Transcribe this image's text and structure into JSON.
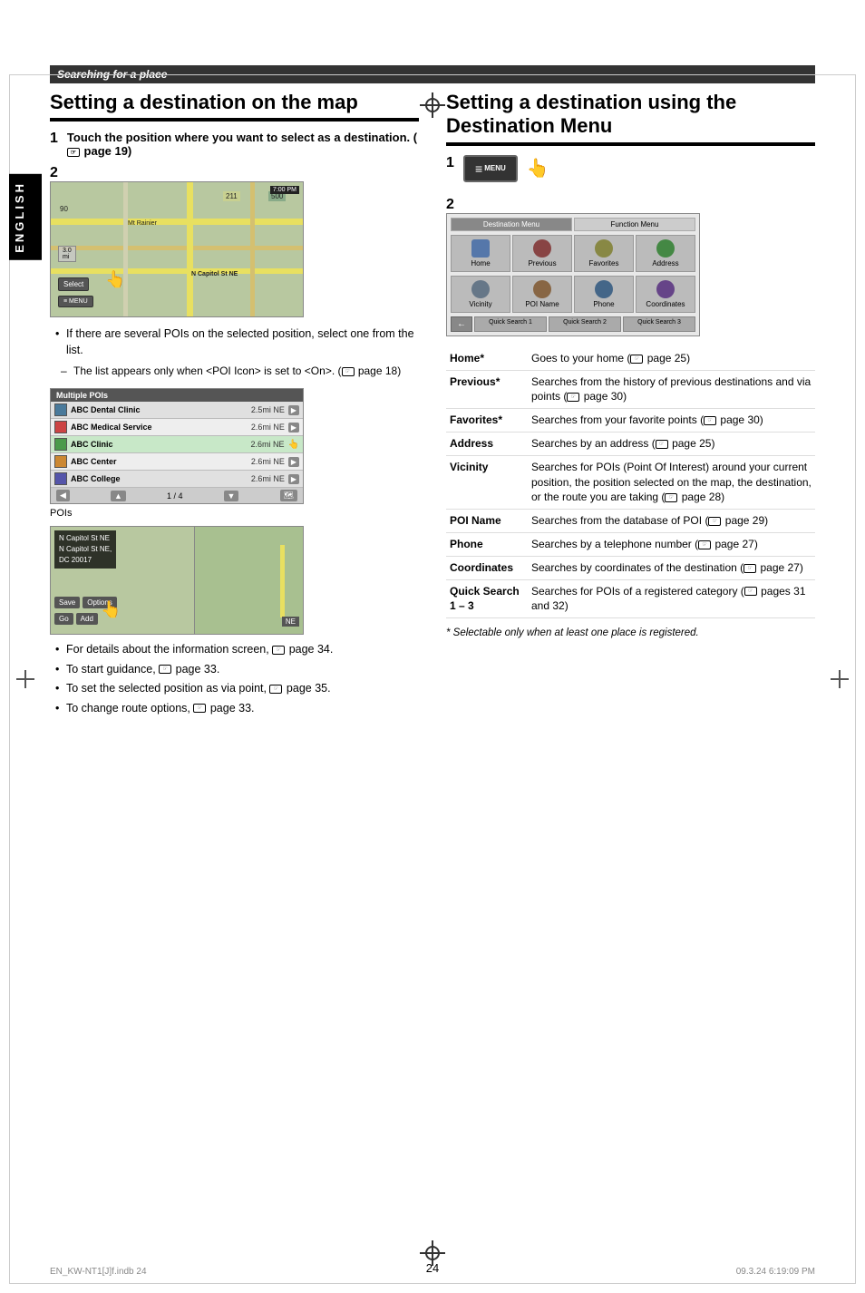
{
  "page": {
    "number": "24",
    "file_info": "EN_KW-NT1[J]f.indb   24",
    "date_info": "09.3.24   6:19:09 PM"
  },
  "header": {
    "section_title": "Searching for a place"
  },
  "left_section": {
    "title": "Setting a destination on the map",
    "step1": {
      "num": "1",
      "text": "Touch the position where you want to select as a destination.",
      "page_ref": "page 19"
    },
    "step2": {
      "num": "2"
    },
    "bullets": [
      "If there are several POIs on the selected position, select one from the list.",
      "The list appears only when <POI Icon> is set to <On>. (☞ page 18)"
    ],
    "pois_label": "POIs",
    "poi_list": {
      "header": "Multiple POIs",
      "items": [
        {
          "name": "ABC Dental Clinic",
          "dist": "2.5mi NE"
        },
        {
          "name": "ABC Medical Service",
          "dist": "2.6mi NE"
        },
        {
          "name": "ABC Clinic",
          "dist": "2.6mi NE"
        },
        {
          "name": "ABC Center",
          "dist": "2.6mi NE"
        },
        {
          "name": "ABC College",
          "dist": "2.6mi NE"
        }
      ],
      "page_indicator": "1 / 4"
    },
    "bottom_bullets": [
      "For details about the information screen, ☞ page 34.",
      "To start guidance, ☞ page 33.",
      "To set the selected position as via point, ☞ page 35.",
      "To change route options, ☞ page 33."
    ]
  },
  "right_section": {
    "title": "Setting a destination using the Destination Menu",
    "step1": {
      "num": "1"
    },
    "step2": {
      "num": "2"
    },
    "menu_button_label": "MENU",
    "dest_menu": {
      "tabs": [
        "Destination Menu",
        "Function Menu"
      ],
      "grid_row1": [
        {
          "label": "Home"
        },
        {
          "label": "Previous"
        },
        {
          "label": "Favorites"
        },
        {
          "label": "Address"
        }
      ],
      "grid_row2": [
        {
          "label": "Vicinity"
        },
        {
          "label": "POI Name"
        },
        {
          "label": "Phone"
        },
        {
          "label": "Coordinates"
        }
      ],
      "quick_buttons": [
        "Quick Search 1",
        "Quick Search 2",
        "Quick Search 3"
      ]
    },
    "table": [
      {
        "item": "Home*",
        "desc": "Goes to your home (☞ page 25)"
      },
      {
        "item": "Previous*",
        "desc": "Searches from the history of previous destinations and via points (☞ page 30)"
      },
      {
        "item": "Favorites*",
        "desc": "Searches from your favorite points (☞ page 30)"
      },
      {
        "item": "Address",
        "desc": "Searches by an address (☞ page 25)"
      },
      {
        "item": "Vicinity",
        "desc": "Searches for POIs (Point Of Interest) around your current position, the position selected on the map, the destination, or the route you are taking (☞ page 28)"
      },
      {
        "item": "POI Name",
        "desc": "Searches from the database of POI (☞ page 29)"
      },
      {
        "item": "Phone",
        "desc": "Searches by a telephone number (☞ page 27)"
      },
      {
        "item": "Coordinates",
        "desc": "Searches by coordinates of the destination (☞ page 27)"
      },
      {
        "item": "Quick Search 1 – 3",
        "desc": "Searches for POIs of a registered category (☞ pages 31 and 32)"
      }
    ],
    "footnote": "* Selectable only when at least one place is registered."
  }
}
